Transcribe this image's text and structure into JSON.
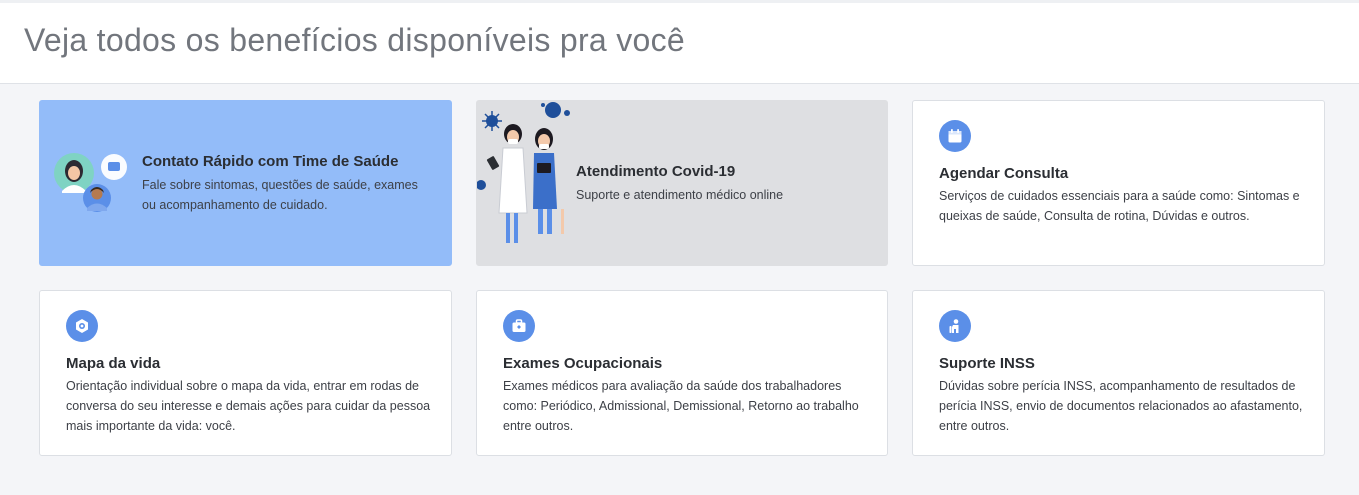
{
  "header": {
    "title": "Veja todos os benefícios disponíveis pra você"
  },
  "cards": [
    {
      "title": "Contato Rápido com Time de Saúde",
      "description": "Fale sobre sintomas, questões de saúde, exames ou acompanhamento de cuidado.",
      "icon": "doctor-chat-illustration",
      "background": "#93bcf9"
    },
    {
      "title": "Atendimento Covid-19",
      "description": "Suporte e atendimento médico online",
      "icon": "covid-doctors-illustration",
      "background": "#dedfe2"
    },
    {
      "title": "Agendar Consulta",
      "description": "Serviços de cuidados essenciais para a saúde como: Sintomas e queixas de saúde, Consulta de rotina, Dúvidas e outros.",
      "icon": "calendar-icon"
    },
    {
      "title": "Mapa da vida",
      "description": "Orientação individual sobre o mapa da vida, entrar em rodas de conversa do seu interesse e demais ações para cuidar da pessoa mais importante da vida: você.",
      "icon": "compass-icon"
    },
    {
      "title": "Exames Ocupacionais",
      "description": "Exames médicos para avaliação da saúde dos trabalhadores como: Periódico, Admissional, Demissional, Retorno ao trabalho entre outros.",
      "icon": "briefcase-icon"
    },
    {
      "title": "Suporte INSS",
      "description": "Dúvidas sobre perícia INSS, acompanhamento de resultados de perícia INSS, envio de documentos relacionados ao afastamento, entre outros.",
      "icon": "person-support-icon"
    }
  ],
  "colors": {
    "accent": "#5b8fe8",
    "page_bg": "#f4f5f8"
  }
}
